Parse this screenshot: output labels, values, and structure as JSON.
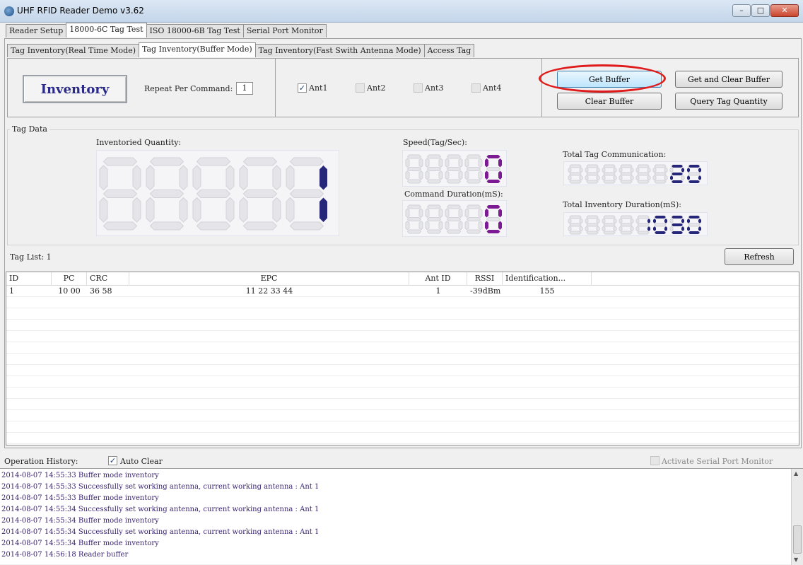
{
  "window": {
    "title": "UHF RFID Reader Demo v3.62",
    "minimize_glyph": "–",
    "maximize_glyph": "□",
    "close_glyph": "✕"
  },
  "main_tabs": [
    {
      "label": "Reader Setup",
      "active": false
    },
    {
      "label": "18000-6C Tag Test",
      "active": true
    },
    {
      "label": "ISO 18000-6B Tag Test",
      "active": false
    },
    {
      "label": "Serial Port Monitor",
      "active": false
    }
  ],
  "sub_tabs": [
    {
      "label": "Tag Inventory(Real Time Mode)",
      "active": false
    },
    {
      "label": "Tag Inventory(Buffer Mode)",
      "active": true
    },
    {
      "label": "Tag Inventory(Fast Swith Antenna Mode)",
      "active": false
    },
    {
      "label": "Access Tag",
      "active": false
    }
  ],
  "controls": {
    "inventory_label": "Inventory",
    "repeat_label": "Repeat Per Command:",
    "repeat_value": "1",
    "antennas": [
      {
        "label": "Ant1",
        "checked": true
      },
      {
        "label": "Ant2",
        "checked": false
      },
      {
        "label": "Ant3",
        "checked": false
      },
      {
        "label": "Ant4",
        "checked": false
      }
    ],
    "check_glyph": "✓",
    "get_buffer": "Get Buffer",
    "get_and_clear": "Get and Clear Buffer",
    "clear_buffer": "Clear Buffer",
    "query_tag_quantity": "Query Tag Quantity"
  },
  "tag_data": {
    "group_label": "Tag Data",
    "inventoried_quantity_label": "Inventoried Quantity:",
    "inventoried_quantity": "1",
    "speed_label": "Speed(Tag/Sec):",
    "speed": "0",
    "command_duration_label": "Command Duration(mS):",
    "command_duration": "0",
    "total_comm_label": "Total Tag Communication:",
    "total_comm": "20",
    "total_inv_duration_label": "Total Inventory Duration(mS):",
    "total_inv_duration": "1030"
  },
  "colors": {
    "digit_blue": "#27277a",
    "digit_purple": "#7b1a93",
    "highlight_ring": "#e01b1b"
  },
  "tag_list": {
    "label": "Tag List: 1",
    "refresh": "Refresh",
    "columns": [
      "ID",
      "PC",
      "CRC",
      "EPC",
      "Ant ID",
      "RSSI",
      "Identification..."
    ],
    "rows": [
      [
        "1",
        "10 00",
        "36 58",
        "11 22 33 44",
        "1",
        "-39dBm",
        "155"
      ]
    ]
  },
  "history": {
    "label": "Operation History:",
    "auto_clear_label": "Auto Clear",
    "auto_clear_checked": true,
    "activate_monitor_label": "Activate Serial Port Monitor",
    "activate_monitor_checked": false,
    "scroll_up_glyph": "▲",
    "scroll_down_glyph": "▼",
    "lines": [
      "2014-08-07 14:55:33 Buffer mode inventory",
      "2014-08-07 14:55:33 Successfully set working antenna, current working antenna : Ant 1",
      "2014-08-07 14:55:33 Buffer mode inventory",
      "2014-08-07 14:55:34 Successfully set working antenna, current working antenna : Ant 1",
      "2014-08-07 14:55:34 Buffer mode inventory",
      "2014-08-07 14:55:34 Successfully set working antenna, current working antenna : Ant 1",
      "2014-08-07 14:55:34 Buffer mode inventory",
      "2014-08-07 14:56:18 Reader buffer"
    ]
  }
}
